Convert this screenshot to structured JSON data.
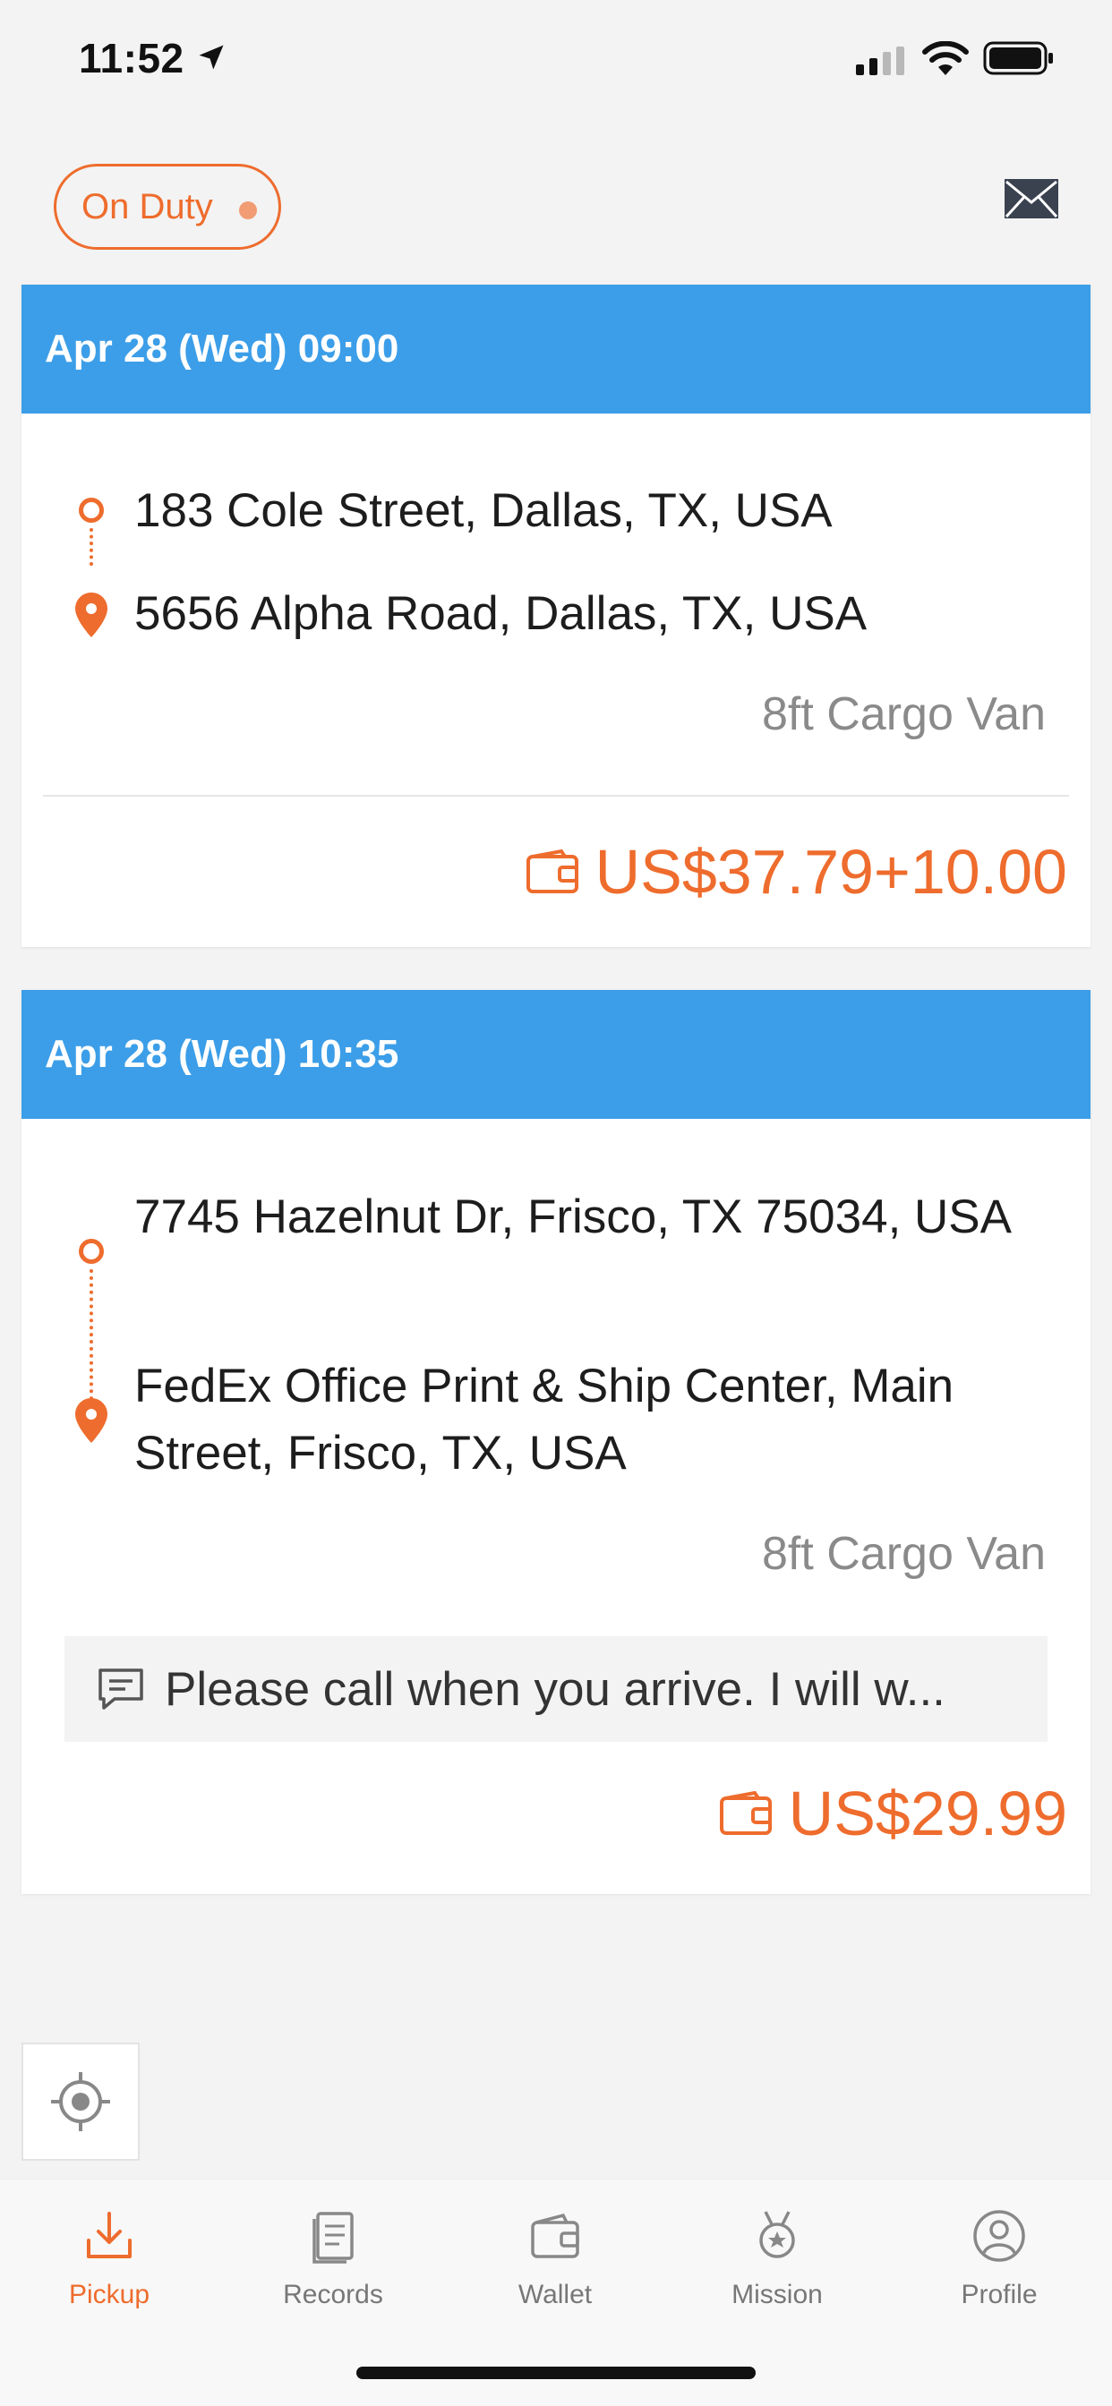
{
  "status_bar": {
    "time": "11:52"
  },
  "header": {
    "duty_label": "On Duty"
  },
  "orders": [
    {
      "datetime": "Apr 28 (Wed) 09:00",
      "pickup": "183 Cole Street, Dallas, TX, USA",
      "dropoff": "5656 Alpha Road, Dallas, TX, USA",
      "vehicle": "8ft Cargo Van",
      "price": "US$37.79+10.00"
    },
    {
      "datetime": "Apr 28 (Wed) 10:35",
      "pickup": "7745 Hazelnut Dr, Frisco, TX 75034, USA",
      "dropoff": "FedEx Office Print & Ship Center, Main Street, Frisco, TX, USA",
      "vehicle": "8ft Cargo Van",
      "note": "Please call when you arrive. I will w...",
      "price": "US$29.99"
    }
  ],
  "tabs": [
    {
      "label": "Pickup",
      "icon": "download-icon",
      "active": true
    },
    {
      "label": "Records",
      "icon": "document-icon",
      "active": false
    },
    {
      "label": "Wallet",
      "icon": "wallet-icon",
      "active": false
    },
    {
      "label": "Mission",
      "icon": "medal-icon",
      "active": false
    },
    {
      "label": "Profile",
      "icon": "user-icon",
      "active": false
    }
  ],
  "colors": {
    "accent": "#ee6c2d",
    "header_blue": "#3c9ee8",
    "background": "#f3f3f3"
  }
}
